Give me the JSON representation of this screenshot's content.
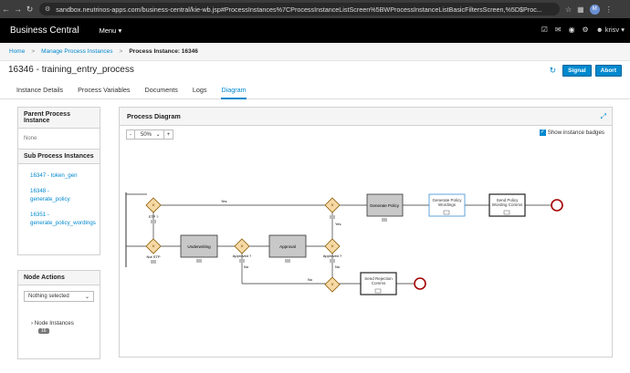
{
  "browser": {
    "url": "sandbox.neutrinos-apps.com/business-central/kie-wb.jsp#ProcessInstances%7CProcessInstanceListScreen%5BWProcessInstanceListBasicFiltersScreen,%5D$Proc...",
    "avatar_letter": "M"
  },
  "app": {
    "brand": "Business Central",
    "menu_label": "Menu",
    "user": "krisv"
  },
  "breadcrumb": {
    "home": "Home",
    "manage": "Manage Process Instances",
    "current": "Process Instance: 16346"
  },
  "instance": {
    "title": "16346 - training_entry_process",
    "signal_label": "Signal",
    "abort_label": "Abort"
  },
  "tabs": [
    {
      "label": "Instance Details"
    },
    {
      "label": "Process Variables"
    },
    {
      "label": "Documents"
    },
    {
      "label": "Logs"
    },
    {
      "label": "Diagram",
      "active": true
    }
  ],
  "parent_panel": {
    "title": "Parent Process Instance",
    "none_text": "None",
    "sub_title": "Sub Process Instances",
    "sub_items": [
      {
        "label": "16347 - token_gen"
      },
      {
        "label": "16348 - generate_policy"
      },
      {
        "label": "16351 - generate_policy_wordings"
      }
    ]
  },
  "node_actions": {
    "title": "Node Actions",
    "select_value": "Nothing selected",
    "node_instances_label": "Node Instances",
    "node_instances_count": "16"
  },
  "diagram": {
    "title": "Process Diagram",
    "zoom_minus": "-",
    "zoom_value": "50%",
    "zoom_plus": "+",
    "show_badges_label": "Show instance badges",
    "nodes": {
      "gw1": "STP ?",
      "gw2": "Not STP",
      "underwriting": "Underwriting",
      "approved1": "Approved ?",
      "approval": "Approval",
      "approved2": "Approved ?",
      "generate_policy": "Generate Policy",
      "generate_policy_wordings": "Generate Policy Wordings",
      "send_policy_wording_comms": "Send Policy Wording Comms",
      "send_rejection_comms": "Send Rejection Comms"
    },
    "edge_labels": {
      "yes1": "Yes",
      "yes2": "Yes",
      "no1": "No",
      "no2": "No",
      "no3": "No"
    }
  },
  "colors": {
    "accent": "#0088ce",
    "gateway_fill": "#f6d9a6",
    "end_event": "#a30000"
  }
}
